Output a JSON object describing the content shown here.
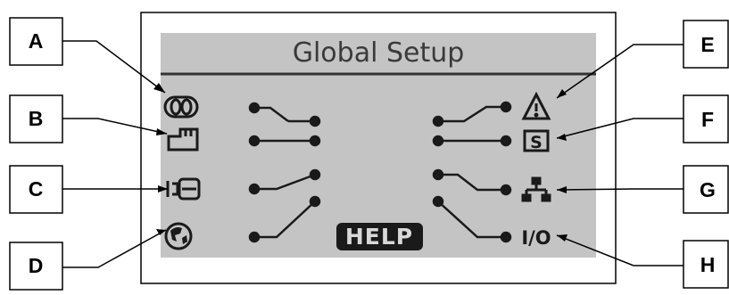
{
  "screen": {
    "title": "Global Setup",
    "help_label": "HELP"
  },
  "callouts": [
    "A",
    "B",
    "C",
    "D",
    "E",
    "F",
    "G",
    "H"
  ],
  "icons": {
    "left": [
      "loop-icon",
      "memory-card-icon",
      "camera-icon",
      "globe-icon"
    ],
    "right": [
      "warning-icon",
      "s-box-icon",
      "network-icon",
      "io-icon"
    ]
  },
  "icon_text": {
    "s_box": "S",
    "io": "I/O"
  },
  "colors": {
    "screen_bg": "#c4c4c4",
    "frame": "#000000",
    "ink": "#1a1a1a"
  }
}
